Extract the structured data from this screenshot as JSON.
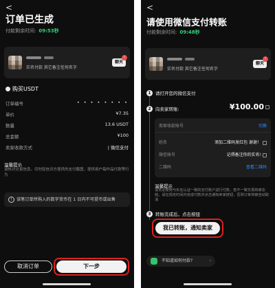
{
  "left": {
    "back": "<",
    "title": "订单已生成",
    "timer_label": "付款剩余时间:",
    "timer_value": "09:53秒",
    "seller": {
      "note": "实名付款 其它备注任何名字",
      "chat_label": "聊天",
      "badge": "!"
    },
    "section_title": "购买USDT",
    "rows": [
      {
        "label": "订单编号",
        "value": "• • • • • • • •"
      },
      {
        "label": "单价",
        "value": "¥7.35"
      },
      {
        "label": "数量",
        "value": "13.6 USDT"
      },
      {
        "label": "总金额",
        "value": "¥100"
      },
      {
        "label": "卖家收款方式",
        "value": "| 微信支付"
      }
    ],
    "notes_title": "温馨提示",
    "notes_body": "请核对交易信息，切勿轻信对方提供的支付截图，提供用户每作品付款等行为",
    "warning": "该笔订单所购入的数字货币在 1 日内不可提币或出售",
    "warning_icon": "!",
    "cancel_label": "取消订单",
    "next_label": "下一步"
  },
  "right": {
    "back": "<",
    "title": "请使用微信支付转账",
    "timer_label": "付款剩余时间:",
    "timer_value": "09:48秒",
    "seller": {
      "note": "实名付款 其它备注任何名字",
      "chat_label": "聊天",
      "badge": "!"
    },
    "steps": [
      {
        "n": "1",
        "label": "请打开您的微信支付"
      },
      {
        "n": "2",
        "label": "向卖家转账:"
      },
      {
        "n": "3",
        "label": "转账完成后，点击按钮"
      }
    ],
    "amount": "¥100.00",
    "pay_card": {
      "header_label": "卖家收款账号",
      "header_link": "切换",
      "rows": [
        {
          "label": "姓名",
          "value": "添加二维码发红包 谢谢！"
        },
        {
          "label": "微信账号",
          "value": "记得备注你的实名!"
        },
        {
          "label": "二维码",
          "value": "查看二维码"
        }
      ]
    },
    "notes_title": "温馨提示",
    "notes_body": "请务必使用与实名认证一致的支付账户进行付款，若不一致交易将被冻结。请在规定时间内完成付款并点击通知卖家按钮，否则订单将被自动取消",
    "confirm_label": "我已转账，通知卖家",
    "help_label": "不知道如何付款?",
    "help_chevron": "›"
  }
}
